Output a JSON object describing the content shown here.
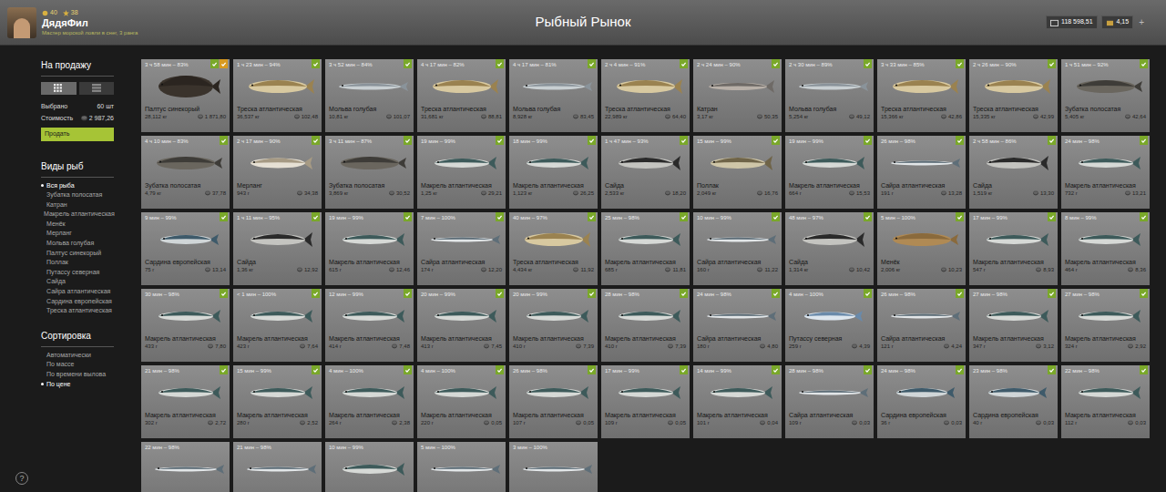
{
  "header": {
    "level": "40",
    "stars": "38",
    "player": "ДядяФил",
    "rank": "Мастер морской ловли в снег, 3 ранга",
    "title": "Рыбный Рынок",
    "money": "118 598,51",
    "gold": "4,15",
    "add": "+"
  },
  "sidebar": {
    "sale_title": "На продажу",
    "views": [
      {
        "kind": "grid",
        "selected": true
      },
      {
        "kind": "list",
        "selected": false
      }
    ],
    "selected_label": "Выбрано",
    "selected_count": "60 шт",
    "value_label": "Стоимость",
    "value": "2 987,26",
    "sell": "Продать",
    "types_title": "Виды рыб",
    "types": [
      {
        "label": "Вся рыба",
        "selected": true
      },
      {
        "label": "Зубатка полосатая",
        "selected": false
      },
      {
        "label": "Катран",
        "selected": false
      },
      {
        "label": "Макрель атлантическая",
        "selected": false
      },
      {
        "label": "Менёк",
        "selected": false
      },
      {
        "label": "Мерланг",
        "selected": false
      },
      {
        "label": "Мольва голубая",
        "selected": false
      },
      {
        "label": "Палтус синекорый",
        "selected": false
      },
      {
        "label": "Поллак",
        "selected": false
      },
      {
        "label": "Путассу северная",
        "selected": false
      },
      {
        "label": "Сайда",
        "selected": false
      },
      {
        "label": "Сайра атлантическая",
        "selected": false
      },
      {
        "label": "Сардина европейская",
        "selected": false
      },
      {
        "label": "Треска атлантическая",
        "selected": false
      }
    ],
    "sort_title": "Сортировка",
    "sorts": [
      {
        "label": "Автоматически",
        "selected": false
      },
      {
        "label": "По массе",
        "selected": false
      },
      {
        "label": "По времени вылова",
        "selected": false
      },
      {
        "label": "По цене",
        "selected": true
      }
    ],
    "help": "?"
  },
  "fish": [
    {
      "time": "3 ч 58 мин – 83%",
      "name": "Палтус синекорый",
      "weight": "28,112 кг",
      "price": "1 871,80",
      "kind": "halibut",
      "selected": true,
      "favorite": true
    },
    {
      "time": "1 ч 23 мин – 94%",
      "name": "Треска атлантическая",
      "weight": "36,537 кг",
      "price": "102,48",
      "kind": "cod",
      "selected": true,
      "favorite": false
    },
    {
      "time": "3 ч 52 мин – 84%",
      "name": "Мольва голубая",
      "weight": "10,81 кг",
      "price": "101,07",
      "kind": "ling",
      "selected": true,
      "favorite": false
    },
    {
      "time": "4 ч 17 мин – 82%",
      "name": "Треска атлантическая",
      "weight": "31,681 кг",
      "price": "88,81",
      "kind": "cod",
      "selected": true,
      "favorite": false
    },
    {
      "time": "4 ч 17 мин – 81%",
      "name": "Мольва голубая",
      "weight": "8,928 кг",
      "price": "83,45",
      "kind": "ling",
      "selected": true,
      "favorite": false
    },
    {
      "time": "2 ч 4 мин – 91%",
      "name": "Треска атлантическая",
      "weight": "22,989 кг",
      "price": "64,40",
      "kind": "cod",
      "selected": true,
      "favorite": false
    },
    {
      "time": "2 ч 24 мин – 90%",
      "name": "Катран",
      "weight": "3,17 кг",
      "price": "50,35",
      "kind": "shark",
      "selected": true,
      "favorite": false
    },
    {
      "time": "2 ч 30 мин – 89%",
      "name": "Мольва голубая",
      "weight": "5,254 кг",
      "price": "49,12",
      "kind": "ling",
      "selected": true,
      "favorite": false
    },
    {
      "time": "3 ч 33 мин – 85%",
      "name": "Треска атлантическая",
      "weight": "15,366 кг",
      "price": "42,86",
      "kind": "cod",
      "selected": true,
      "favorite": false
    },
    {
      "time": "2 ч 26 мин – 90%",
      "name": "Треска атлантическая",
      "weight": "15,335 кг",
      "price": "42,99",
      "kind": "cod",
      "selected": true,
      "favorite": false
    },
    {
      "time": "1 ч 51 мин – 92%",
      "name": "Зубатка полосатая",
      "weight": "5,405 кг",
      "price": "42,64",
      "kind": "wolffish",
      "selected": true,
      "favorite": false
    },
    {
      "time": "4 ч 10 мин – 83%",
      "name": "Зубатка полосатая",
      "weight": "4,79 кг",
      "price": "37,78",
      "kind": "wolffish",
      "selected": true,
      "favorite": false
    },
    {
      "time": "2 ч 17 мин – 90%",
      "name": "Мерланг",
      "weight": "943 г",
      "price": "34,38",
      "kind": "whiting",
      "selected": true,
      "favorite": false
    },
    {
      "time": "3 ч 11 мин – 87%",
      "name": "Зубатка полосатая",
      "weight": "3,869 кг",
      "price": "30,52",
      "kind": "wolffish",
      "selected": true,
      "favorite": false
    },
    {
      "time": "19 мин – 99%",
      "name": "Макрель атлантическая",
      "weight": "1,25 кг",
      "price": "29,21",
      "kind": "mackerel",
      "selected": true,
      "favorite": false
    },
    {
      "time": "18 мин – 99%",
      "name": "Макрель атлантическая",
      "weight": "1,123 кг",
      "price": "26,25",
      "kind": "mackerel",
      "selected": true,
      "favorite": false
    },
    {
      "time": "1 ч 47 мин – 93%",
      "name": "Сайда",
      "weight": "2,533 кг",
      "price": "18,20",
      "kind": "saithe",
      "selected": true,
      "favorite": false
    },
    {
      "time": "15 мин – 99%",
      "name": "Поллак",
      "weight": "2,049 кг",
      "price": "16,76",
      "kind": "pollack",
      "selected": true,
      "favorite": false
    },
    {
      "time": "19 мин – 99%",
      "name": "Макрель атлантическая",
      "weight": "664 г",
      "price": "15,53",
      "kind": "mackerel",
      "selected": true,
      "favorite": false
    },
    {
      "time": "26 мин – 98%",
      "name": "Сайра атлантическая",
      "weight": "191 г",
      "price": "13,28",
      "kind": "saury",
      "selected": true,
      "favorite": false
    },
    {
      "time": "2 ч 58 мин – 86%",
      "name": "Сайда",
      "weight": "1,519 кг",
      "price": "13,30",
      "kind": "saithe",
      "selected": true,
      "favorite": false
    },
    {
      "time": "24 мин – 98%",
      "name": "Макрель атлантическая",
      "weight": "732 г",
      "price": "13,21",
      "kind": "mackerel",
      "selected": true,
      "favorite": false
    },
    {
      "time": "9 мин – 99%",
      "name": "Сардина европейская",
      "weight": "75 г",
      "price": "13,14",
      "kind": "sardine",
      "selected": true,
      "favorite": false
    },
    {
      "time": "1 ч 11 мин – 95%",
      "name": "Сайда",
      "weight": "1,36 кг",
      "price": "12,92",
      "kind": "saithe",
      "selected": true,
      "favorite": false
    },
    {
      "time": "19 мин – 99%",
      "name": "Макрель атлантическая",
      "weight": "615 г",
      "price": "12,46",
      "kind": "mackerel",
      "selected": true,
      "favorite": false
    },
    {
      "time": "7 мин – 100%",
      "name": "Сайра атлантическая",
      "weight": "174 г",
      "price": "12,20",
      "kind": "saury",
      "selected": true,
      "favorite": false
    },
    {
      "time": "40 мин – 97%",
      "name": "Треска атлантическая",
      "weight": "4,434 кг",
      "price": "11,92",
      "kind": "cod",
      "selected": true,
      "favorite": false
    },
    {
      "time": "25 мин – 98%",
      "name": "Макрель атлантическая",
      "weight": "685 г",
      "price": "11,81",
      "kind": "mackerel",
      "selected": true,
      "favorite": false
    },
    {
      "time": "10 мин – 99%",
      "name": "Сайра атлантическая",
      "weight": "160 г",
      "price": "11,22",
      "kind": "saury",
      "selected": true,
      "favorite": false
    },
    {
      "time": "48 мин – 97%",
      "name": "Сайда",
      "weight": "1,314 кг",
      "price": "10,42",
      "kind": "saithe",
      "selected": true,
      "favorite": false
    },
    {
      "time": "5 мин – 100%",
      "name": "Менёк",
      "weight": "2,006 кг",
      "price": "10,23",
      "kind": "tusk",
      "selected": true,
      "favorite": false
    },
    {
      "time": "17 мин – 99%",
      "name": "Макрель атлантическая",
      "weight": "547 г",
      "price": "8,93",
      "kind": "mackerel",
      "selected": true,
      "favorite": false
    },
    {
      "time": "8 мин – 99%",
      "name": "Макрель атлантическая",
      "weight": "464 г",
      "price": "8,36",
      "kind": "mackerel",
      "selected": true,
      "favorite": false
    },
    {
      "time": "30 мин – 98%",
      "name": "Макрель атлантическая",
      "weight": "433 г",
      "price": "7,80",
      "kind": "mackerel",
      "selected": true,
      "favorite": false
    },
    {
      "time": "< 1 мин – 100%",
      "name": "Макрель атлантическая",
      "weight": "423 г",
      "price": "7,64",
      "kind": "mackerel",
      "selected": true,
      "favorite": false
    },
    {
      "time": "12 мин – 99%",
      "name": "Макрель атлантическая",
      "weight": "414 г",
      "price": "7,48",
      "kind": "mackerel",
      "selected": true,
      "favorite": false
    },
    {
      "time": "20 мин – 99%",
      "name": "Макрель атлантическая",
      "weight": "413 г",
      "price": "7,45",
      "kind": "mackerel",
      "selected": true,
      "favorite": false
    },
    {
      "time": "20 мин – 99%",
      "name": "Макрель атлантическая",
      "weight": "410 г",
      "price": "7,39",
      "kind": "mackerel",
      "selected": true,
      "favorite": false
    },
    {
      "time": "28 мин – 98%",
      "name": "Макрель атлантическая",
      "weight": "410 г",
      "price": "7,39",
      "kind": "mackerel",
      "selected": true,
      "favorite": false
    },
    {
      "time": "24 мин – 98%",
      "name": "Сайра атлантическая",
      "weight": "180 г",
      "price": "4,80",
      "kind": "saury",
      "selected": true,
      "favorite": false
    },
    {
      "time": "4 мин – 100%",
      "name": "Путассу северная",
      "weight": "259 г",
      "price": "4,39",
      "kind": "bluewhiting",
      "selected": true,
      "favorite": false
    },
    {
      "time": "26 мин – 98%",
      "name": "Сайра атлантическая",
      "weight": "121 г",
      "price": "4,24",
      "kind": "saury",
      "selected": true,
      "favorite": false
    },
    {
      "time": "27 мин – 98%",
      "name": "Макрель атлантическая",
      "weight": "347 г",
      "price": "3,12",
      "kind": "mackerel",
      "selected": true,
      "favorite": false
    },
    {
      "time": "27 мин – 98%",
      "name": "Макрель атлантическая",
      "weight": "324 г",
      "price": "2,92",
      "kind": "mackerel",
      "selected": true,
      "favorite": false
    },
    {
      "time": "21 мин – 98%",
      "name": "Макрель атлантическая",
      "weight": "302 г",
      "price": "2,72",
      "kind": "mackerel",
      "selected": true,
      "favorite": false
    },
    {
      "time": "15 мин – 99%",
      "name": "Макрель атлантическая",
      "weight": "280 г",
      "price": "2,52",
      "kind": "mackerel",
      "selected": true,
      "favorite": false
    },
    {
      "time": "4 мин – 100%",
      "name": "Макрель атлантическая",
      "weight": "264 г",
      "price": "2,38",
      "kind": "mackerel",
      "selected": true,
      "favorite": false
    },
    {
      "time": "4 мин – 100%",
      "name": "Макрель атлантическая",
      "weight": "220 г",
      "price": "0,05",
      "kind": "mackerel",
      "selected": true,
      "favorite": false
    },
    {
      "time": "26 мин – 98%",
      "name": "Макрель атлантическая",
      "weight": "107 г",
      "price": "0,05",
      "kind": "mackerel",
      "selected": true,
      "favorite": false
    },
    {
      "time": "17 мин – 99%",
      "name": "Макрель атлантическая",
      "weight": "109 г",
      "price": "0,05",
      "kind": "mackerel",
      "selected": true,
      "favorite": false
    },
    {
      "time": "14 мин – 99%",
      "name": "Макрель атлантическая",
      "weight": "101 г",
      "price": "0,04",
      "kind": "mackerel",
      "selected": true,
      "favorite": false
    },
    {
      "time": "28 мин – 98%",
      "name": "Сайра атлантическая",
      "weight": "109 г",
      "price": "0,03",
      "kind": "saury",
      "selected": true,
      "favorite": false
    },
    {
      "time": "24 мин – 98%",
      "name": "Сардина европейская",
      "weight": "36 г",
      "price": "0,03",
      "kind": "sardine",
      "selected": true,
      "favorite": false
    },
    {
      "time": "23 мин – 98%",
      "name": "Сардина европейская",
      "weight": "40 г",
      "price": "0,03",
      "kind": "sardine",
      "selected": true,
      "favorite": false
    },
    {
      "time": "22 мин – 98%",
      "name": "Макрель атлантическая",
      "weight": "112 г",
      "price": "0,03",
      "kind": "mackerel",
      "selected": true,
      "favorite": false
    },
    {
      "time": "22 мин – 98%",
      "kind": "saury",
      "selected": false,
      "favorite": false
    },
    {
      "time": "21 мин – 98%",
      "kind": "saury",
      "selected": false,
      "favorite": false
    },
    {
      "time": "10 мин – 99%",
      "kind": "mackerel",
      "selected": false,
      "favorite": false
    },
    {
      "time": "5 мин – 100%",
      "kind": "saury",
      "selected": false,
      "favorite": false
    },
    {
      "time": "3 мин – 100%",
      "kind": "saury",
      "selected": false,
      "favorite": false
    }
  ]
}
